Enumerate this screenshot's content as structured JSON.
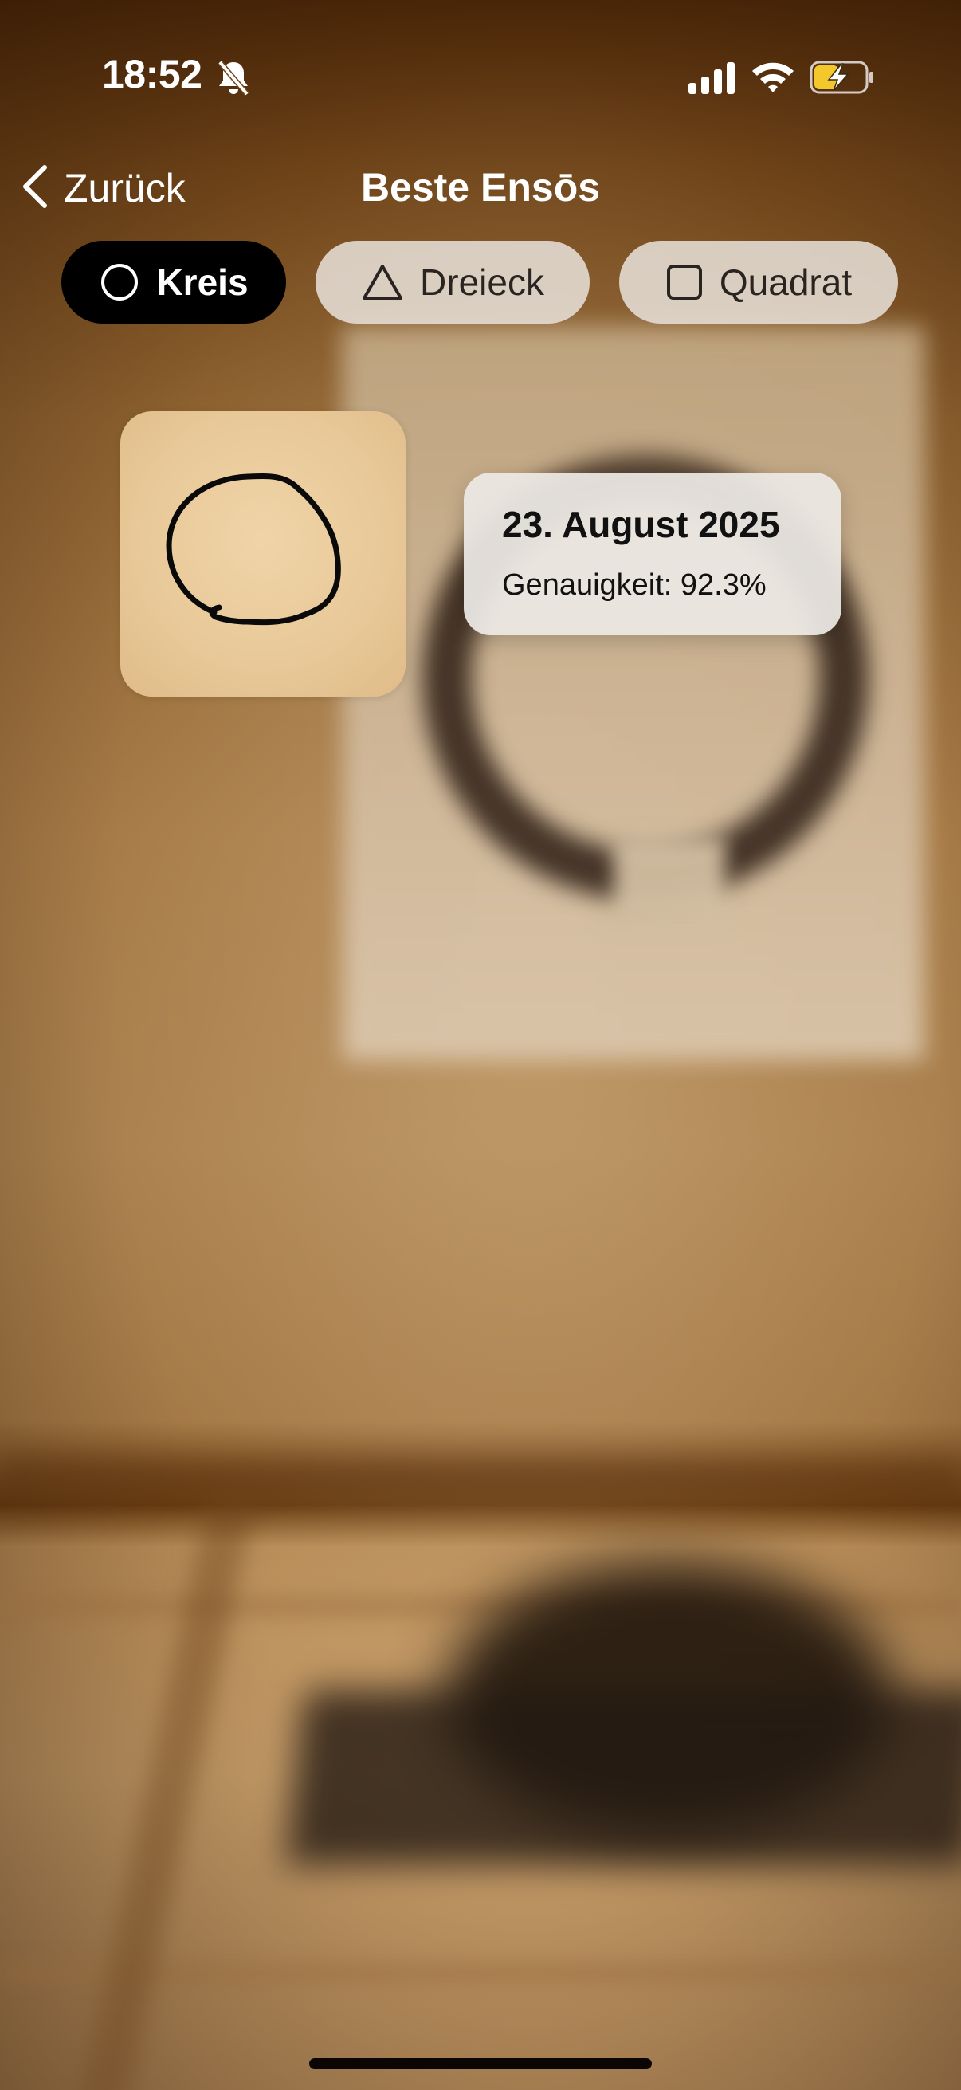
{
  "status_bar": {
    "time": "18:52",
    "icons": [
      "bell-muted-icon",
      "cellular-signal-icon",
      "wifi-icon",
      "battery-charging-icon"
    ],
    "battery_color": "#f2c82c"
  },
  "nav": {
    "back_label": "Zurück",
    "title": "Beste Ensōs"
  },
  "tabs": [
    {
      "label": "Kreis",
      "icon": "circle-icon",
      "active": true
    },
    {
      "label": "Dreieck",
      "icon": "triangle-icon",
      "active": false
    },
    {
      "label": "Quadrat",
      "icon": "square-icon",
      "active": false
    }
  ],
  "entries": [
    {
      "shape": "circle",
      "date": "23. August 2025",
      "accuracy": "Genauigkeit: 92.3%"
    }
  ],
  "colors": {
    "active_tab_bg": "#000000",
    "inactive_tab_bg": "#e6ded6",
    "card_paper": "#ebcb9c"
  }
}
